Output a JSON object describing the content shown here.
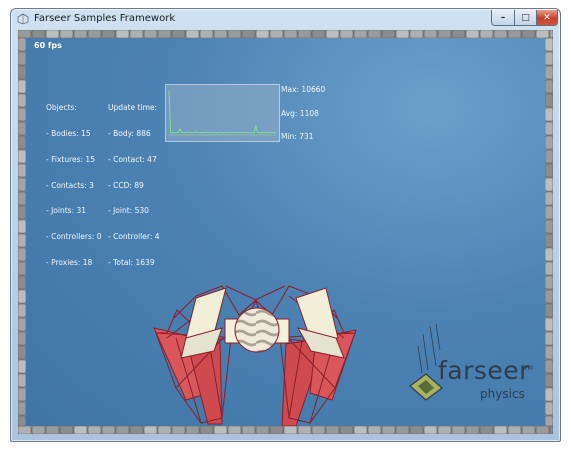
{
  "window": {
    "title": "Farseer Samples Framework",
    "buttons": {
      "minimize": "–",
      "maximize": "□",
      "close": "✕"
    }
  },
  "hud": {
    "fps": "60 fps",
    "objects_header": "Objects:",
    "objects": [
      "- Bodies: 15",
      "- Fixtures: 15",
      "- Contacts: 3",
      "- Joints: 31",
      "- Controllers: 0",
      "- Proxies: 18"
    ],
    "update_header": "Update time:",
    "update": [
      "- Body: 886",
      "- Contact: 47",
      "- CCD: 89",
      "- Joint: 530",
      "- Controller: 4",
      "- Total: 1639"
    ],
    "graph": {
      "max_label": "Max: 10660",
      "avg_label": "Avg: 1108",
      "min_label": "Min: 731",
      "samples": [
        1.0,
        0.06,
        0.05,
        0.05,
        0.05,
        0.05,
        0.06,
        0.14,
        0.06,
        0.05,
        0.05,
        0.05,
        0.06,
        0.07,
        0.05,
        0.05,
        0.06,
        0.08,
        0.06,
        0.05,
        0.05,
        0.06,
        0.05,
        0.06,
        0.07,
        0.05,
        0.05,
        0.06,
        0.05,
        0.05,
        0.06,
        0.05,
        0.05,
        0.07,
        0.06,
        0.05,
        0.05,
        0.06,
        0.05,
        0.06,
        0.05,
        0.05,
        0.06,
        0.05,
        0.05,
        0.06,
        0.07,
        0.05,
        0.05,
        0.06,
        0.05,
        0.05,
        0.05,
        0.06,
        0.05,
        0.05,
        0.22,
        0.06,
        0.05,
        0.05,
        0.06,
        0.05,
        0.05,
        0.06,
        0.05,
        0.05,
        0.05,
        0.06,
        0.05,
        0.05
      ]
    }
  },
  "logo": {
    "word": "farseer",
    "sub": "physics",
    "tm": "TM"
  },
  "colors": {
    "background": "#4d83b4",
    "graph_line": "#7ee08a",
    "red_panel": "#d9575a",
    "cream_panel": "#f1efd6",
    "truss": "#8b1d2a"
  }
}
